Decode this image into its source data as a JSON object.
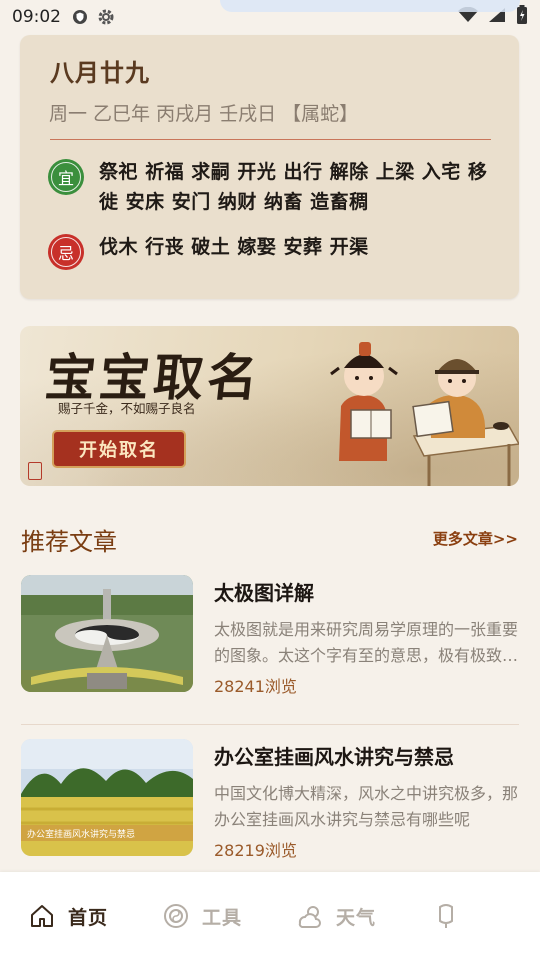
{
  "status_bar": {
    "time": "09:02",
    "icons": [
      "vpn-shield-icon",
      "settings-gear-icon",
      "wifi-icon",
      "signal-icon",
      "battery-icon"
    ]
  },
  "almanac": {
    "lunar_date": "八月廿九",
    "ganzhi": "周一 乙巳年 丙戌月 壬戌日 【属蛇】",
    "yi_badge": "宜",
    "yi_items": "祭祀 祈福 求嗣 开光 出行 解除 上梁 入宅 移徙 安床 安门 纳财 纳畜 造畜稠",
    "ji_badge": "忌",
    "ji_items": "伐木 行丧 破土 嫁娶 安葬 开渠"
  },
  "banner": {
    "title": "宝宝取名",
    "subtitle": "赐子千金，不如赐子良名",
    "button_label": "开始取名"
  },
  "section": {
    "title": "推荐文章",
    "more_label": "更多文章>>"
  },
  "articles": [
    {
      "title": "太极图详解",
      "summary": "太极图就是用来研究周易学原理的一张重要的图象。太这个字有至的意思，极有极致的意思",
      "views": "28241浏览"
    },
    {
      "title": "办公室挂画风水讲究与禁忌",
      "summary": "中国文化博大精深，风水之中讲究极多，那办公室挂画风水讲究与禁忌有哪些呢",
      "views": "28219浏览",
      "thumb_caption": "办公室挂画风水讲究与禁忌"
    }
  ],
  "nav": {
    "items": [
      {
        "label": "首页",
        "icon": "home-icon",
        "active": true
      },
      {
        "label": "工具",
        "icon": "bagua-icon",
        "active": false
      },
      {
        "label": "天气",
        "icon": "weather-icon",
        "active": false
      },
      {
        "label": "",
        "icon": "profile-icon",
        "active": false
      }
    ]
  },
  "colors": {
    "card_bg": "#eadfcd",
    "accent_brown": "#7a3d12",
    "yi_green": "#3b8f3d",
    "ji_red": "#c8302a"
  }
}
